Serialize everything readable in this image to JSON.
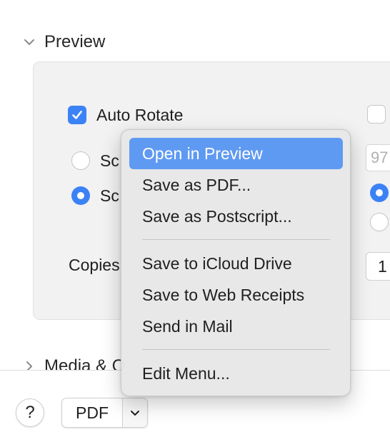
{
  "preview_section": {
    "title": "Preview",
    "auto_rotate": {
      "label": "Auto Rotate",
      "checked": true
    },
    "scale_option_1": {
      "label": "Sc",
      "selected": false
    },
    "scale_option_2": {
      "label": "Sc",
      "selected": true
    },
    "right_checkbox": {
      "checked": false
    },
    "right_number_field": {
      "value": "97"
    },
    "right_radio_1": {
      "selected": true
    },
    "right_radio_2": {
      "selected": false
    },
    "copies": {
      "label": "Copies",
      "value": "1"
    }
  },
  "media_section": {
    "title": "Media & Q"
  },
  "bottom_bar": {
    "help_label": "?",
    "pdf_label": "PDF"
  },
  "pdf_menu": {
    "items": [
      {
        "label": "Open in Preview",
        "selected": true
      },
      {
        "label": "Save as PDF..."
      },
      {
        "label": "Save as Postscript..."
      },
      {
        "label": "Save to iCloud Drive"
      },
      {
        "label": "Save to Web Receipts"
      },
      {
        "label": "Send in Mail"
      },
      {
        "label": "Edit Menu..."
      }
    ]
  },
  "colors": {
    "accent": "#3b82f6",
    "menu_highlight": "#5f9af2",
    "panel_bg": "#f2f2f2"
  }
}
